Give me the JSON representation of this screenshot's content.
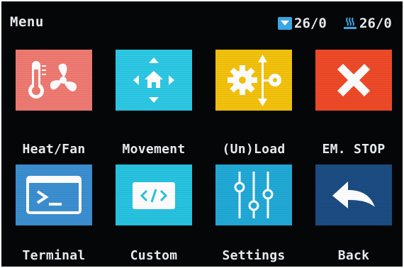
{
  "header": {
    "title": "Menu",
    "nozzle_temp": "26/0",
    "bed_temp": "26/0"
  },
  "menu": {
    "items": [
      {
        "label": "Heat/Fan",
        "icon": "thermometer-fan-icon",
        "color": "#ee7a72"
      },
      {
        "label": "Movement",
        "icon": "move-arrows-icon",
        "color": "#2cc8e4"
      },
      {
        "label": "(Un)Load",
        "icon": "gear-arrow-icon",
        "color": "#f3c20c"
      },
      {
        "label": "EM. STOP",
        "icon": "x-cross-icon",
        "color": "#ee4a28"
      },
      {
        "label": "Terminal",
        "icon": "terminal-icon",
        "color": "#3b8fd0"
      },
      {
        "label": "Custom",
        "icon": "code-icon",
        "color": "#27c3e0"
      },
      {
        "label": "Settings",
        "icon": "sliders-icon",
        "color": "#21a9d6"
      },
      {
        "label": "Back",
        "icon": "back-arrow-icon",
        "color": "#1b4c82"
      }
    ]
  },
  "colors": {
    "background": "#050608",
    "text": "#e9eef2",
    "status_icon": "#3aa9e8"
  }
}
